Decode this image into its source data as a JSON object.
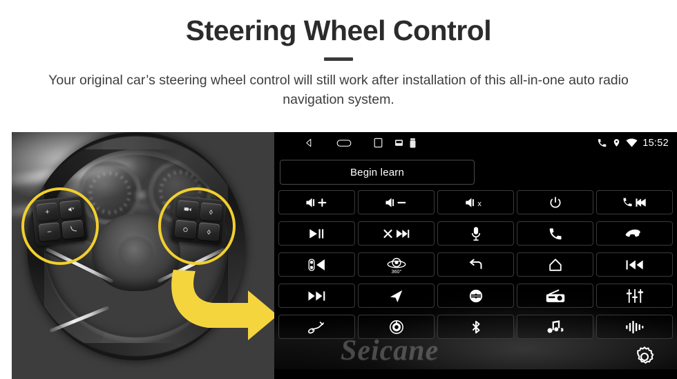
{
  "header": {
    "title": "Steering Wheel Control",
    "subtitle": "Your original car’s steering wheel control will still work after installation of this all-in-one auto radio navigation system."
  },
  "colors": {
    "accent_yellow": "#F2CF2E",
    "arrow_yellow": "#F5D53D",
    "panel_background": "#000000",
    "page_background": "#FFFFFF",
    "title_color": "#2B2B2B",
    "button_border": "#3A3A3A"
  },
  "photo": {
    "name": "steering-wheel-photo",
    "description": "Grayscale photo of a car steering wheel with two yellow highlight circles around the left and right steering wheel control button pods, and a yellow curved arrow pointing to the right toward the head unit screen.",
    "left_pod_keys": [
      "+",
      "mute-speaker",
      "−",
      "phone"
    ],
    "right_pod_keys": [
      "source",
      "up-arrow",
      "circle",
      "down-arrow"
    ]
  },
  "head_unit": {
    "statusbar": {
      "nav": [
        {
          "name": "back-icon",
          "label": "Back"
        },
        {
          "name": "home-icon",
          "label": "Home"
        },
        {
          "name": "recents-icon",
          "label": "Recents"
        }
      ],
      "indicators": [
        {
          "name": "sdcard-icon",
          "label": "SD Card"
        },
        {
          "name": "usb-icon",
          "label": "USB"
        },
        {
          "name": "phone-icon",
          "label": "Phone"
        },
        {
          "name": "location-icon",
          "label": "Location"
        },
        {
          "name": "wifi-icon",
          "label": "Wi-Fi"
        }
      ],
      "clock": "15:52"
    },
    "begin_learn_label": "Begin learn",
    "watermark": "Seicane",
    "settings_button": {
      "name": "settings-gear-icon",
      "label": "Settings"
    },
    "grid": {
      "rows": 5,
      "columns": 5,
      "buttons": [
        {
          "icon": "volume-up-icon",
          "label": "Volume Up"
        },
        {
          "icon": "volume-down-icon",
          "label": "Volume Down"
        },
        {
          "icon": "mute-icon",
          "label": "Mute"
        },
        {
          "icon": "power-icon",
          "label": "Power"
        },
        {
          "icon": "phone-previous-icon",
          "label": "Phone Previous"
        },
        {
          "icon": "play-pause-icon",
          "label": "Play / Pause"
        },
        {
          "icon": "shuffle-next-icon",
          "label": "Shuffle / Next"
        },
        {
          "icon": "microphone-icon",
          "label": "Voice"
        },
        {
          "icon": "phone-answer-icon",
          "label": "Answer Call"
        },
        {
          "icon": "phone-hangup-icon",
          "label": "Hang Up"
        },
        {
          "icon": "parking-sensor-icon",
          "label": "Parking Sensor"
        },
        {
          "icon": "camera-360-icon",
          "label": "360° Camera",
          "text": "360°"
        },
        {
          "icon": "back-arrow-icon",
          "label": "Back"
        },
        {
          "icon": "home-house-icon",
          "label": "Home"
        },
        {
          "icon": "previous-track-icon",
          "label": "Previous Track"
        },
        {
          "icon": "next-track-icon",
          "label": "Next Track"
        },
        {
          "icon": "navigation-arrow-icon",
          "label": "Navigation"
        },
        {
          "icon": "mode-source-icon",
          "label": "Mode / Source"
        },
        {
          "icon": "radio-icon",
          "label": "Radio"
        },
        {
          "icon": "equalizer-icon",
          "label": "Equalizer"
        },
        {
          "icon": "aux-cable-icon",
          "label": "AUX"
        },
        {
          "icon": "dial-knob-icon",
          "label": "Dial"
        },
        {
          "icon": "bluetooth-icon",
          "label": "Bluetooth"
        },
        {
          "icon": "bluetooth-music-icon",
          "label": "Bluetooth Music"
        },
        {
          "icon": "audio-wave-icon",
          "label": "Audio Wave"
        }
      ]
    }
  }
}
